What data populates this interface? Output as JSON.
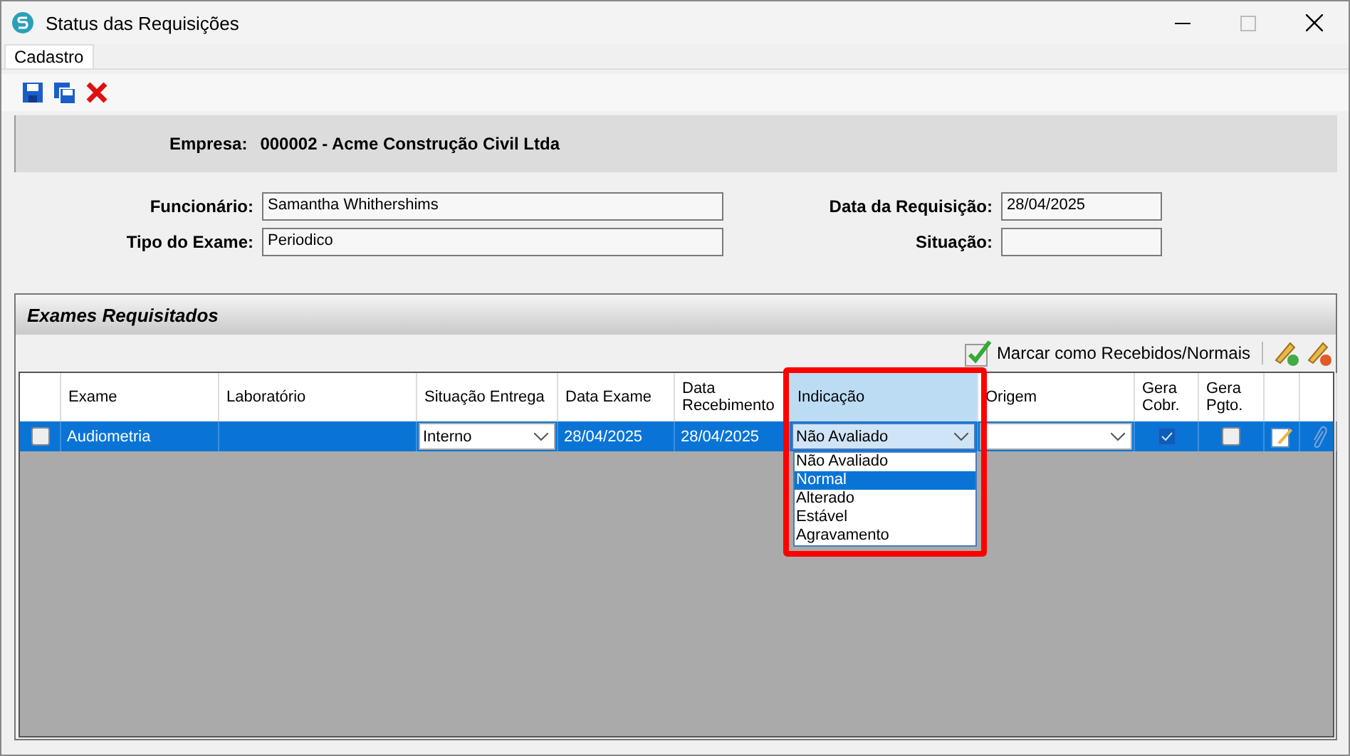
{
  "window": {
    "title": "Status das Requisições"
  },
  "tabs": [
    {
      "label": "Cadastro",
      "selected": true
    }
  ],
  "company": {
    "label": "Empresa:",
    "value": "000002 - Acme Construção Civil Ltda"
  },
  "fields": [
    {
      "label": "Funcionário:",
      "value": "Samantha Whithershims"
    },
    {
      "label": "Data da Requisição:",
      "value": "28/04/2025"
    },
    {
      "label": "Tipo do Exame:",
      "value": "Periodico"
    },
    {
      "label": "Situação:"
    }
  ],
  "group": {
    "title": "Exames Requisitados",
    "action": "Marcar como Recebidos/Normais"
  },
  "columns": [
    {
      "selected": false
    },
    {
      "label": "Exame",
      "selected": false
    },
    {
      "label": "Laboratório",
      "selected": false
    },
    {
      "label": "Situação Entrega",
      "selected": false
    },
    {
      "label": "Data Exame",
      "selected": false
    },
    {
      "label": "Data Recebimento",
      "selected": false
    },
    {
      "label": "Indicação",
      "selected": true
    },
    {
      "label": "Origem",
      "selected": false
    },
    {
      "label": "Gera Cobr.",
      "selected": false
    },
    {
      "label": "Gera Pgto.",
      "selected": false
    },
    {
      "selected": false
    },
    {
      "selected": false
    }
  ],
  "rows": [
    {
      "checked": false,
      "exame": "Audiometria",
      "situacao": "Interno",
      "data_exame": "28/04/2025",
      "data_recebimento": "28/04/2025",
      "indicacao": "Não Avaliado",
      "gera_cobr": true,
      "gera_pgto": false
    }
  ],
  "dropdown": {
    "options": [
      {
        "label": "Não Avaliado",
        "selected": false
      },
      {
        "label": "Normal",
        "selected": true
      },
      {
        "label": "Alterado",
        "selected": false
      },
      {
        "label": "Estável",
        "selected": false
      },
      {
        "label": "Agravamento",
        "selected": false
      }
    ]
  }
}
